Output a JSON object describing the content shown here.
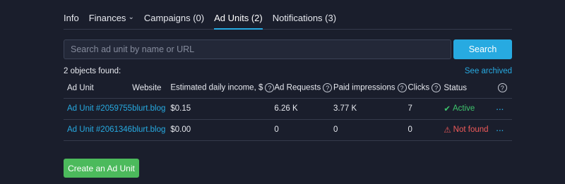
{
  "tabs": [
    {
      "label": "Info"
    },
    {
      "label": "Finances"
    },
    {
      "label": "Campaigns (0)"
    },
    {
      "label": "Ad Units (2)",
      "active": true
    },
    {
      "label": "Notifications (3)"
    }
  ],
  "search": {
    "placeholder": "Search ad unit by name or URL",
    "button_label": "Search"
  },
  "results": {
    "count_text": "2 objects found:",
    "archived_link": "See archived"
  },
  "table": {
    "headers": [
      "Ad Unit",
      "Website",
      "Estimated daily income, $",
      "Ad Requests",
      "Paid impressions",
      "Clicks",
      "Status"
    ],
    "help_glyph": "?",
    "rows": [
      {
        "ad_unit": "Ad Unit #2059755",
        "website": "blurt.blog",
        "income": "$0.15",
        "requests": "6.26 K",
        "impressions": "3.77 K",
        "clicks": "7",
        "status": "Active",
        "status_kind": "active"
      },
      {
        "ad_unit": "Ad Unit #2061346",
        "website": "blurt.blog",
        "income": "$0.00",
        "requests": "0",
        "impressions": "0",
        "clicks": "0",
        "status": "Not found",
        "status_kind": "error"
      }
    ],
    "row_menu_glyph": "···"
  },
  "create_button_label": "Create an Ad Unit",
  "colors": {
    "background": "#1a1e2c",
    "accent": "#27aae1",
    "success": "#3ec46d",
    "error": "#f05a5a",
    "create_button": "#4cba5c"
  }
}
